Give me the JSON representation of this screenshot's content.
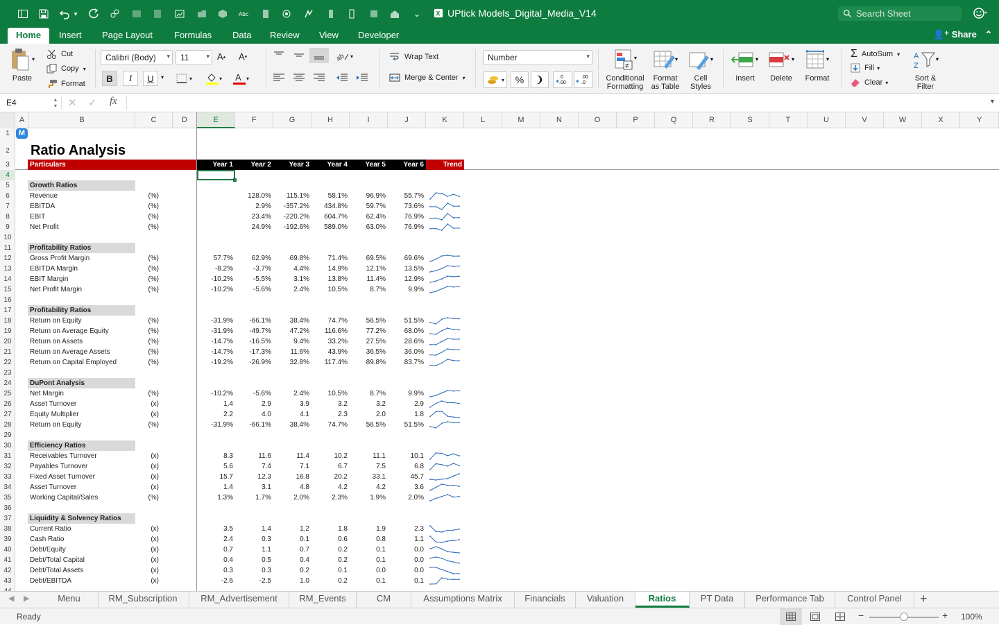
{
  "title_bar": {
    "file_name": "UPtick Models_Digital_Media_V14",
    "search_placeholder": "Search Sheet"
  },
  "ribbon_tabs": [
    "Home",
    "Insert",
    "Page Layout",
    "Formulas",
    "Data",
    "Review",
    "View",
    "Developer"
  ],
  "share_label": "Share",
  "ribbon": {
    "paste": "Paste",
    "cut": "Cut",
    "copy": "Copy",
    "format_painter": "Format",
    "font_name": "Calibri (Body)",
    "font_size": "11",
    "wrap_text": "Wrap Text",
    "merge_center": "Merge & Center",
    "number_format": "Number",
    "conditional_formatting": [
      "Conditional",
      "Formatting"
    ],
    "format_as_table": [
      "Format",
      "as Table"
    ],
    "cell_styles": [
      "Cell",
      "Styles"
    ],
    "insert": "Insert",
    "delete": "Delete",
    "format": "Format",
    "autosum": "AutoSum",
    "fill": "Fill",
    "clear": "Clear",
    "sort_filter": [
      "Sort &",
      "Filter"
    ],
    "bold": "B",
    "italic": "I",
    "underline": "U",
    "percent": "%"
  },
  "formula_bar": {
    "name_box": "E4",
    "fx": "fx",
    "value": ""
  },
  "columns": [
    "A",
    "B",
    "C",
    "D",
    "E",
    "F",
    "G",
    "H",
    "I",
    "J",
    "K",
    "L",
    "M",
    "N",
    "O",
    "P",
    "Q",
    "R",
    "S",
    "T",
    "U",
    "V",
    "W",
    "X",
    "Y"
  ],
  "selected_column": "E",
  "sheet": {
    "logo_letter": "M",
    "title": "Ratio Analysis",
    "header": {
      "label": "Particulars",
      "years": [
        "Year 1",
        "Year 2",
        "Year 3",
        "Year 4",
        "Year 5",
        "Year 6"
      ],
      "trend": "Trend"
    },
    "rows": [
      {
        "r": 5,
        "section": "Growth Ratios"
      },
      {
        "r": 6,
        "label": "Revenue",
        "unit": "(%)",
        "v": [
          "",
          "128.0%",
          "115.1%",
          "58.1%",
          "96.9%",
          "55.7%"
        ],
        "t": [
          0,
          128.0,
          115.1,
          58.1,
          96.9,
          55.7
        ]
      },
      {
        "r": 7,
        "label": "EBITDA",
        "unit": "(%)",
        "v": [
          "",
          "2.9%",
          "-357.2%",
          "434.8%",
          "59.7%",
          "73.6%"
        ],
        "t": [
          0,
          2.9,
          -357.2,
          434.8,
          59.7,
          73.6
        ]
      },
      {
        "r": 8,
        "label": "EBIT",
        "unit": "(%)",
        "v": [
          "",
          "23.4%",
          "-220.2%",
          "604.7%",
          "62.4%",
          "76.9%"
        ],
        "t": [
          0,
          23.4,
          -220.2,
          604.7,
          62.4,
          76.9
        ]
      },
      {
        "r": 9,
        "label": "Net Profit",
        "unit": "(%)",
        "v": [
          "",
          "24.9%",
          "-192.6%",
          "589.0%",
          "63.0%",
          "76.9%"
        ],
        "t": [
          0,
          24.9,
          -192.6,
          589.0,
          63.0,
          76.9
        ]
      },
      {
        "r": 11,
        "section": "Profitability Ratios"
      },
      {
        "r": 12,
        "label": "Gross Profit Margin",
        "unit": "(%)",
        "v": [
          "57.7%",
          "62.9%",
          "69.8%",
          "71.4%",
          "69.5%",
          "69.6%"
        ]
      },
      {
        "r": 13,
        "label": "EBITDA Margin",
        "unit": "(%)",
        "v": [
          "-8.2%",
          "-3.7%",
          "4.4%",
          "14.9%",
          "12.1%",
          "13.5%"
        ]
      },
      {
        "r": 14,
        "label": "EBIT Margin",
        "unit": "(%)",
        "v": [
          "-10.2%",
          "-5.5%",
          "3.1%",
          "13.8%",
          "11.4%",
          "12.9%"
        ]
      },
      {
        "r": 15,
        "label": "Net Profit Margin",
        "unit": "(%)",
        "v": [
          "-10.2%",
          "-5.6%",
          "2.4%",
          "10.5%",
          "8.7%",
          "9.9%"
        ]
      },
      {
        "r": 17,
        "section": "Profitability Ratios"
      },
      {
        "r": 18,
        "label": "Return on Equity",
        "unit": "(%)",
        "v": [
          "-31.9%",
          "-66.1%",
          "38.4%",
          "74.7%",
          "56.5%",
          "51.5%"
        ]
      },
      {
        "r": 19,
        "label": "Return on Average Equity",
        "unit": "(%)",
        "v": [
          "-31.9%",
          "-49.7%",
          "47.2%",
          "116.6%",
          "77.2%",
          "68.0%"
        ]
      },
      {
        "r": 20,
        "label": "Return on Assets",
        "unit": "(%)",
        "v": [
          "-14.7%",
          "-16.5%",
          "9.4%",
          "33.2%",
          "27.5%",
          "28.6%"
        ]
      },
      {
        "r": 21,
        "label": "Return on Average Assets",
        "unit": "(%)",
        "v": [
          "-14.7%",
          "-17.3%",
          "11.6%",
          "43.9%",
          "36.5%",
          "36.0%"
        ]
      },
      {
        "r": 22,
        "label": "Return on Capital Employed",
        "unit": "(%)",
        "v": [
          "-19.2%",
          "-26.9%",
          "32.8%",
          "117.4%",
          "89.8%",
          "83.7%"
        ]
      },
      {
        "r": 24,
        "section": "DuPont Analysis"
      },
      {
        "r": 25,
        "label": "Net Margin",
        "unit": "(%)",
        "v": [
          "-10.2%",
          "-5.6%",
          "2.4%",
          "10.5%",
          "8.7%",
          "9.9%"
        ]
      },
      {
        "r": 26,
        "label": "Asset Turnover",
        "unit": "(x)",
        "v": [
          "1.4",
          "2.9",
          "3.9",
          "3.2",
          "3.2",
          "2.9"
        ]
      },
      {
        "r": 27,
        "label": "Equity Multiplier",
        "unit": "(x)",
        "v": [
          "2.2",
          "4.0",
          "4.1",
          "2.3",
          "2.0",
          "1.8"
        ]
      },
      {
        "r": 28,
        "label": "Return on Equity",
        "unit": "(%)",
        "v": [
          "-31.9%",
          "-66.1%",
          "38.4%",
          "74.7%",
          "56.5%",
          "51.5%"
        ]
      },
      {
        "r": 30,
        "section": "Efficiency Ratios"
      },
      {
        "r": 31,
        "label": "Receivables Turnover",
        "unit": "(x)",
        "v": [
          "8.3",
          "11.6",
          "11.4",
          "10.2",
          "11.1",
          "10.1"
        ]
      },
      {
        "r": 32,
        "label": "Payables Turnover",
        "unit": "(x)",
        "v": [
          "5.6",
          "7.4",
          "7.1",
          "6.7",
          "7.5",
          "6.8"
        ]
      },
      {
        "r": 33,
        "label": "Fixed Asset Turnover",
        "unit": "(x)",
        "v": [
          "15.7",
          "12.3",
          "16.8",
          "20.2",
          "33.1",
          "45.7"
        ]
      },
      {
        "r": 34,
        "label": "Asset Turnover",
        "unit": "(x)",
        "v": [
          "1.4",
          "3.1",
          "4.8",
          "4.2",
          "4.2",
          "3.6"
        ]
      },
      {
        "r": 35,
        "label": "Working Capital/Sales",
        "unit": "(%)",
        "v": [
          "1.3%",
          "1.7%",
          "2.0%",
          "2.3%",
          "1.9%",
          "2.0%"
        ]
      },
      {
        "r": 37,
        "section": "Liquidity & Solvency Ratios"
      },
      {
        "r": 38,
        "label": "Current Ratio",
        "unit": "(x)",
        "v": [
          "3.5",
          "1.4",
          "1.2",
          "1.8",
          "1.9",
          "2.3"
        ]
      },
      {
        "r": 39,
        "label": "Cash Ratio",
        "unit": "(x)",
        "v": [
          "2.4",
          "0.3",
          "0.1",
          "0.6",
          "0.8",
          "1.1"
        ]
      },
      {
        "r": 40,
        "label": "Debt/Equity",
        "unit": "(x)",
        "v": [
          "0.7",
          "1.1",
          "0.7",
          "0.2",
          "0.1",
          "0.0"
        ]
      },
      {
        "r": 41,
        "label": "Debt/Total Capital",
        "unit": "(x)",
        "v": [
          "0.4",
          "0.5",
          "0.4",
          "0.2",
          "0.1",
          "0.0"
        ]
      },
      {
        "r": 42,
        "label": "Debt/Total Assets",
        "unit": "(x)",
        "v": [
          "0.3",
          "0.3",
          "0.2",
          "0.1",
          "0.0",
          "0.0"
        ]
      },
      {
        "r": 43,
        "label": "Debt/EBITDA",
        "unit": "(x)",
        "v": [
          "-2.6",
          "-2.5",
          "1.0",
          "0.2",
          "0.1",
          "0.1"
        ]
      }
    ]
  },
  "sheet_tabs": [
    "Menu",
    "RM_Subscription",
    "RM_Advertisement",
    "RM_Events",
    "CM",
    "Assumptions Matrix",
    "Financials",
    "Valuation",
    "Ratios",
    "PT Data",
    "Performance Tab",
    "Control Panel"
  ],
  "active_sheet": "Ratios",
  "status": {
    "ready": "Ready",
    "zoom": "100%"
  },
  "colors": {
    "brand": "#0f7c3f",
    "header_red": "#c00000",
    "sparkline": "#2e6db5",
    "section_fill": "#d9d9d9"
  }
}
